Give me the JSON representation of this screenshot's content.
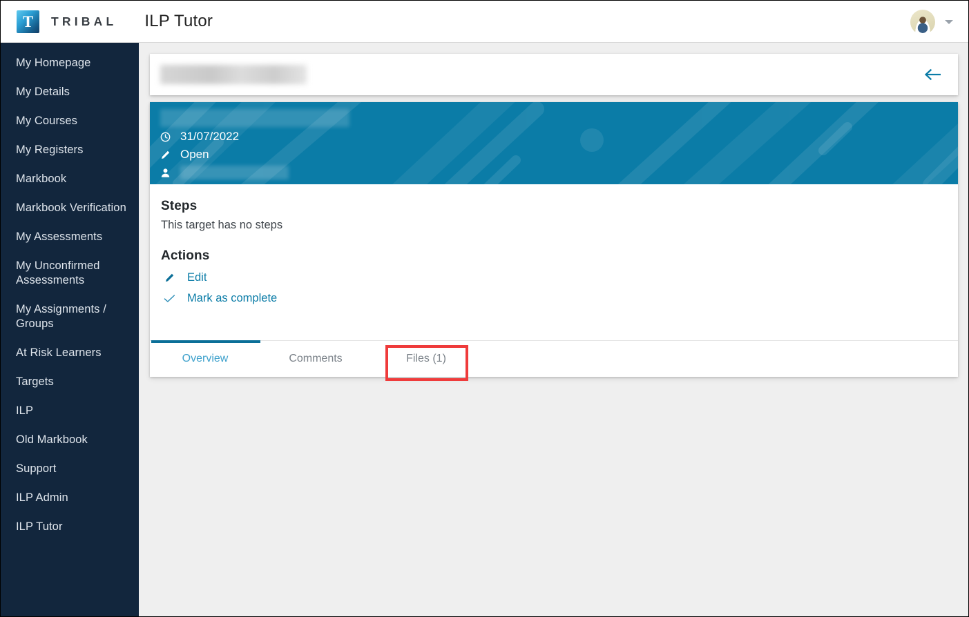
{
  "topbar": {
    "logo_letter": "T",
    "brand": "TRIBAL",
    "app_title": "ILP Tutor",
    "avatar_icon": "user-avatar",
    "caret_icon": "chevron-down-icon"
  },
  "sidebar": {
    "items": [
      {
        "label": "My Homepage",
        "name": "my-homepage"
      },
      {
        "label": "My Details",
        "name": "my-details"
      },
      {
        "label": "My Courses",
        "name": "my-courses"
      },
      {
        "label": "My Registers",
        "name": "my-registers"
      },
      {
        "label": "Markbook",
        "name": "markbook"
      },
      {
        "label": "Markbook Verification",
        "name": "markbook-verification"
      },
      {
        "label": "My Assessments",
        "name": "my-assessments"
      },
      {
        "label": "My Unconfirmed\nAssessments",
        "name": "my-unconfirmed-assessments"
      },
      {
        "label": "My Assignments /\nGroups",
        "name": "my-assignments-groups"
      },
      {
        "label": "At Risk Learners",
        "name": "at-risk-learners"
      },
      {
        "label": "Targets",
        "name": "targets"
      },
      {
        "label": "ILP",
        "name": "ilp"
      },
      {
        "label": "Old Markbook",
        "name": "old-markbook"
      },
      {
        "label": "Support",
        "name": "support"
      },
      {
        "label": "ILP Admin",
        "name": "ilp-admin"
      },
      {
        "label": "ILP Tutor",
        "name": "ilp-tutor"
      }
    ]
  },
  "header_card": {
    "title_redacted": true,
    "back_icon": "arrow-left-icon"
  },
  "banner": {
    "title_redacted": true,
    "date": "31/07/2022",
    "date_icon": "clock-icon",
    "status": "Open",
    "status_icon": "pencil-icon",
    "person_redacted": true,
    "person_icon": "person-icon",
    "background_color": "#0b7ca7"
  },
  "content": {
    "steps_heading": "Steps",
    "steps_empty_text": "This target has no steps",
    "actions_heading": "Actions",
    "actions": [
      {
        "label": "Edit",
        "icon": "pencil-icon",
        "name": "edit"
      },
      {
        "label": "Mark as complete",
        "icon": "check-icon",
        "name": "mark-as-complete"
      }
    ]
  },
  "tabs": {
    "items": [
      {
        "label": "Overview",
        "name": "overview",
        "active": true
      },
      {
        "label": "Comments",
        "name": "comments",
        "active": false
      },
      {
        "label": "Files (1)",
        "name": "files",
        "active": false
      }
    ],
    "highlighted_tab": "Files (1)",
    "highlight_color": "#ef3b3b",
    "active_indicator_color": "#0b6f98"
  },
  "colors": {
    "sidebar": "#12263d",
    "accent": "#0b7ca7",
    "page_background": "#efefef",
    "link": "#0b7ca7"
  }
}
